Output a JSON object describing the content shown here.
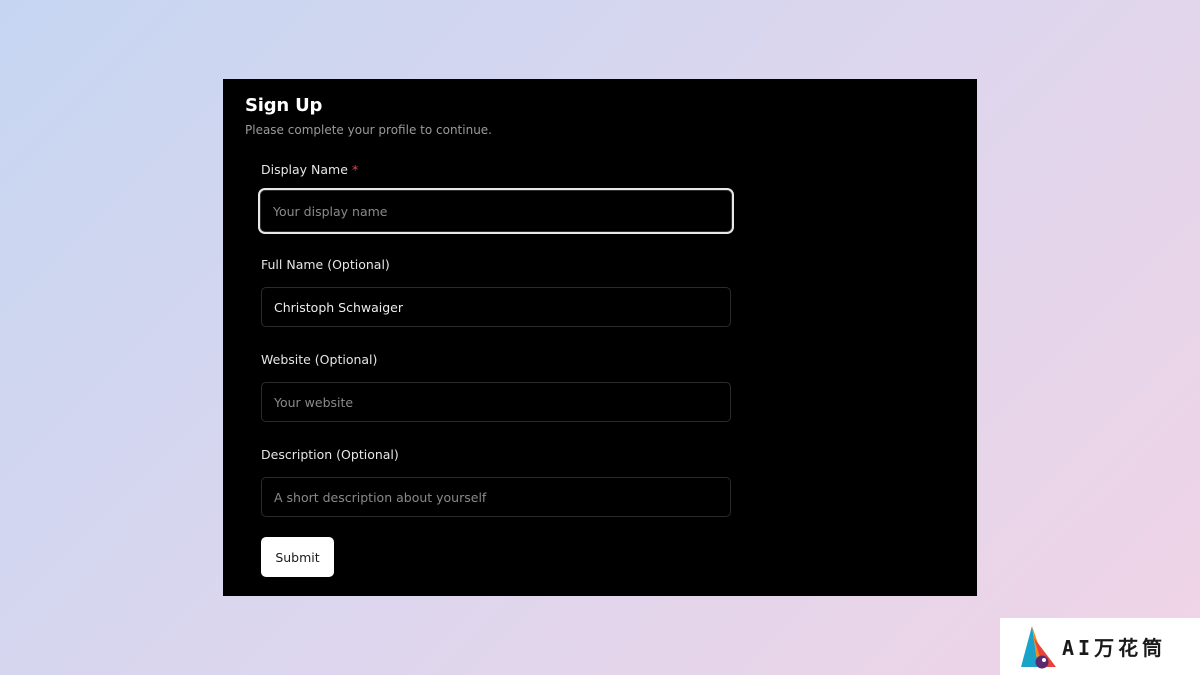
{
  "form": {
    "title": "Sign Up",
    "subtitle": "Please complete your profile to continue.",
    "display_name": {
      "label": "Display Name",
      "required_marker": "*",
      "value": "",
      "placeholder": "Your display name"
    },
    "full_name": {
      "label": "Full Name (Optional)",
      "value": "Christoph Schwaiger",
      "placeholder": ""
    },
    "website": {
      "label": "Website (Optional)",
      "value": "",
      "placeholder": "Your website"
    },
    "description": {
      "label": "Description (Optional)",
      "value": "",
      "placeholder": "A short description about yourself"
    },
    "submit_label": "Submit"
  },
  "watermark": {
    "text": "AI万花筒",
    "logo_icon": "kaleidoscope-logo-icon"
  },
  "colors": {
    "card_background": "#000000",
    "required_marker": "#e5484d",
    "button_background": "#ffffff",
    "input_border": "#2b2b2b",
    "focus_ring": "#e8e8e8"
  }
}
